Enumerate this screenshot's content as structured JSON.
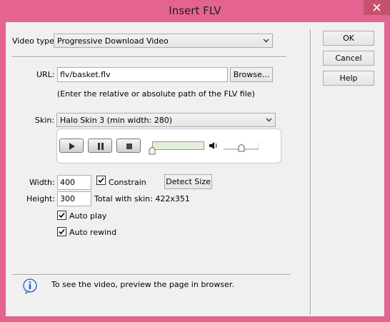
{
  "window": {
    "title": "Insert FLV"
  },
  "form": {
    "video_type_label": "Video type:",
    "video_type_value": "Progressive Download Video",
    "url_label": "URL:",
    "url_value": "flv/basket.flv",
    "browse_label": "Browse...",
    "url_hint": "(Enter the relative or absolute path of the FLV file)",
    "skin_label": "Skin:",
    "skin_value": "Halo Skin 3 (min width: 280)",
    "width_label": "Width:",
    "width_value": "400",
    "constrain_label": "Constrain",
    "constrain_checked": true,
    "detect_size_label": "Detect Size",
    "height_label": "Height:",
    "height_value": "300",
    "total_with_skin": "Total with skin: 422x351",
    "autoplay_label": "Auto play",
    "autoplay_checked": true,
    "autorewind_label": "Auto rewind",
    "autorewind_checked": true
  },
  "footer": {
    "info_text": "To see the video, preview the page in browser.",
    "icon": "info-icon"
  },
  "buttons": {
    "ok": "OK",
    "cancel": "Cancel",
    "help": "Help"
  },
  "colors": {
    "window_frame": "#e4638f",
    "client_bg": "#f0f0f0",
    "seekbar_fill": "#e4eed8"
  }
}
